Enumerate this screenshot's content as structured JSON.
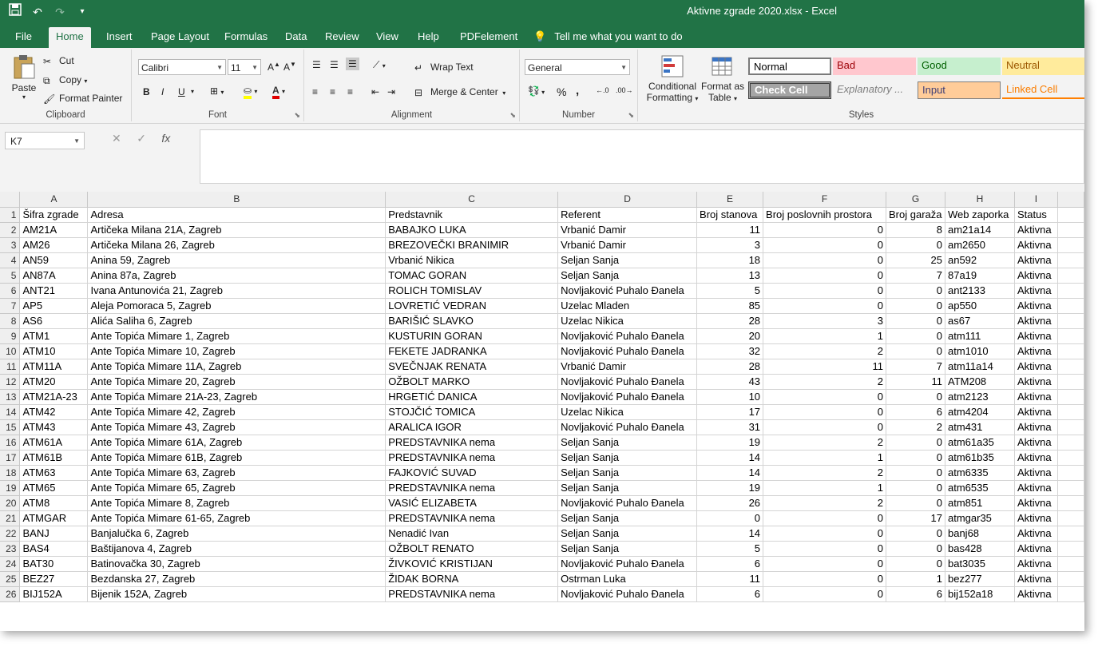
{
  "window": {
    "title": "Aktivne zgrade 2020.xlsx  -  Excel"
  },
  "qat": {
    "save_icon": "save-icon",
    "undo_icon": "undo-icon",
    "redo_icon": "redo-icon",
    "customize_icon": "customize-icon"
  },
  "tabs": [
    "File",
    "Home",
    "Insert",
    "Page Layout",
    "Formulas",
    "Data",
    "Review",
    "View",
    "Help",
    "PDFelement"
  ],
  "tellme": "Tell me what you want to do",
  "ribbon": {
    "clipboard": {
      "label": "Clipboard",
      "paste": "Paste",
      "cut": "Cut",
      "copy": "Copy",
      "format_painter": "Format Painter"
    },
    "font": {
      "label": "Font",
      "name": "Calibri",
      "size": "11",
      "bold": "B",
      "italic": "I",
      "underline": "U"
    },
    "alignment": {
      "label": "Alignment",
      "wrap": "Wrap Text",
      "merge": "Merge & Center"
    },
    "number": {
      "label": "Number",
      "format": "General",
      "percent": "%",
      "comma": ","
    },
    "cond": {
      "line1": "Conditional",
      "line2": "Formatting"
    },
    "fmt_table": {
      "line1": "Format as",
      "line2": "Table"
    },
    "styles": {
      "label": "Styles",
      "normal": "Normal",
      "bad": "Bad",
      "good": "Good",
      "neutral": "Neutral",
      "check": "Check Cell",
      "explanatory": "Explanatory ...",
      "input": "Input",
      "linked": "Linked Cell"
    }
  },
  "formula_bar": {
    "name_box": "K7",
    "fx": "fx"
  },
  "sheet": {
    "columns": [
      "A",
      "B",
      "C",
      "D",
      "E",
      "F",
      "G",
      "H",
      "I"
    ],
    "header": [
      "Šifra zgrade",
      "Adresa",
      "Predstavnik",
      "Referent",
      "Broj stanova",
      "Broj poslovnih prostora",
      "Broj garaža",
      "Web zaporka",
      "Status"
    ],
    "rows": [
      [
        "AM21A",
        "Artičeka Milana 21A, Zagreb",
        "BABAJKO LUKA",
        "Vrbanić Damir",
        "11",
        "0",
        "8",
        "am21a14",
        "Aktivna"
      ],
      [
        "AM26",
        "Artičeka Milana 26, Zagreb",
        "BREZOVEČKI BRANIMIR",
        "Vrbanić Damir",
        "3",
        "0",
        "0",
        "am2650",
        "Aktivna"
      ],
      [
        "AN59",
        "Anina 59, Zagreb",
        "Vrbanić Nikica",
        "Seljan Sanja",
        "18",
        "0",
        "25",
        "an592",
        "Aktivna"
      ],
      [
        "AN87A",
        "Anina 87a, Zagreb",
        "TOMAC GORAN",
        "Seljan Sanja",
        "13",
        "0",
        "7",
        "87a19",
        "Aktivna"
      ],
      [
        "ANT21",
        "Ivana Antunovića 21, Zagreb",
        "ROLICH TOMISLAV",
        "Novljaković Puhalo Đanela",
        "5",
        "0",
        "0",
        "ant2133",
        "Aktivna"
      ],
      [
        "AP5",
        "Aleja Pomoraca 5, Zagreb",
        "LOVRETIĆ VEDRAN",
        "Uzelac Mladen",
        "85",
        "0",
        "0",
        "ap550",
        "Aktivna"
      ],
      [
        "AS6",
        "Alića Saliha 6, Zagreb",
        "BARIŠIĆ SLAVKO",
        "Uzelac Nikica",
        "28",
        "3",
        "0",
        "as67",
        "Aktivna"
      ],
      [
        "ATM1",
        "Ante Topića Mimare 1, Zagreb",
        "KUSTURIN GORAN",
        "Novljaković Puhalo Đanela",
        "20",
        "1",
        "0",
        "atm111",
        "Aktivna"
      ],
      [
        "ATM10",
        "Ante Topića Mimare 10, Zagreb",
        "FEKETE JADRANKA",
        "Novljaković Puhalo Đanela",
        "32",
        "2",
        "0",
        "atm1010",
        "Aktivna"
      ],
      [
        "ATM11A",
        "Ante Topića Mimare 11A, Zagreb",
        "SVEČNJAK RENATA",
        "Vrbanić Damir",
        "28",
        "11",
        "7",
        "atm11a14",
        "Aktivna"
      ],
      [
        "ATM20",
        "Ante Topića Mimare 20, Zagreb",
        "OŽBOLT MARKO",
        "Novljaković Puhalo Đanela",
        "43",
        "2",
        "11",
        "ATM208",
        "Aktivna"
      ],
      [
        "ATM21A-23",
        "Ante Topića Mimare 21A-23, Zagreb",
        "HRGETIĆ DANICA",
        "Novljaković Puhalo Đanela",
        "10",
        "0",
        "0",
        "atm2123",
        "Aktivna"
      ],
      [
        "ATM42",
        "Ante Topića Mimare 42, Zagreb",
        "STOJČIĆ TOMICA",
        "Uzelac Nikica",
        "17",
        "0",
        "6",
        "atm4204",
        "Aktivna"
      ],
      [
        "ATM43",
        "Ante Topića Mimare 43, Zagreb",
        "ARALICA IGOR",
        "Novljaković Puhalo Đanela",
        "31",
        "0",
        "2",
        "atm431",
        "Aktivna"
      ],
      [
        "ATM61A",
        "Ante Topića Mimare 61A, Zagreb",
        "PREDSTAVNIKA nema",
        "Seljan Sanja",
        "19",
        "2",
        "0",
        "atm61a35",
        "Aktivna"
      ],
      [
        "ATM61B",
        "Ante Topića Mimare 61B, Zagreb",
        "PREDSTAVNIKA nema",
        "Seljan Sanja",
        "14",
        "1",
        "0",
        "atm61b35",
        "Aktivna"
      ],
      [
        "ATM63",
        "Ante Topića Mimare 63, Zagreb",
        "FAJKOVIĆ SUVAD",
        "Seljan Sanja",
        "14",
        "2",
        "0",
        "atm6335",
        "Aktivna"
      ],
      [
        "ATM65",
        "Ante Topića Mimare 65, Zagreb",
        "PREDSTAVNIKA nema",
        "Seljan Sanja",
        "19",
        "1",
        "0",
        "atm6535",
        "Aktivna"
      ],
      [
        "ATM8",
        "Ante Topića Mimare 8, Zagreb",
        "VASIĆ ELIZABETA",
        "Novljaković Puhalo Đanela",
        "26",
        "2",
        "0",
        "atm851",
        "Aktivna"
      ],
      [
        "ATMGAR",
        "Ante Topića Mimare 61-65, Zagreb",
        "PREDSTAVNIKA nema",
        "Seljan Sanja",
        "0",
        "0",
        "17",
        "atmgar35",
        "Aktivna"
      ],
      [
        "BANJ",
        "Banjalučka 6, Zagreb",
        "Nenadić Ivan",
        "Seljan Sanja",
        "14",
        "0",
        "0",
        "banj68",
        "Aktivna"
      ],
      [
        "BAS4",
        "Baštijanova 4, Zagreb",
        "OŽBOLT RENATO",
        "Seljan Sanja",
        "5",
        "0",
        "0",
        "bas428",
        "Aktivna"
      ],
      [
        "BAT30",
        "Batinovačka 30, Zagreb",
        "ŽIVKOVIĆ KRISTIJAN",
        "Novljaković Puhalo Đanela",
        "6",
        "0",
        "0",
        "bat3035",
        "Aktivna"
      ],
      [
        "BEZ27",
        "Bezdanska 27, Zagreb",
        "ŽIDAK BORNA",
        "Ostrman Luka",
        "11",
        "0",
        "1",
        "bez277",
        "Aktivna"
      ],
      [
        "BIJ152A",
        "Bijenik 152A, Zagreb",
        "PREDSTAVNIKA nema",
        "Novljaković Puhalo Đanela",
        "6",
        "0",
        "6",
        "bij152a18",
        "Aktivna"
      ]
    ]
  }
}
